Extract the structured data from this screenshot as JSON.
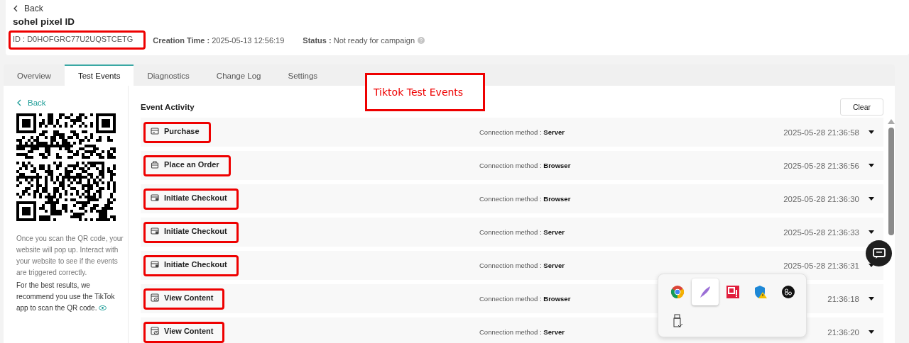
{
  "header": {
    "back": "Back",
    "title": "sohel pixel ID",
    "id_text": "ID : D0HOFGRC77U2UQSTCETG",
    "id_highlighted": true,
    "creation_label": "Creation Time :",
    "creation_value": "2025-05-13 12:56:19",
    "status_label": "Status :",
    "status_value": "Not ready for campaign"
  },
  "tabs": [
    {
      "label": "Overview",
      "selected": false
    },
    {
      "label": "Test Events",
      "selected": true
    },
    {
      "label": "Diagnostics",
      "selected": false
    },
    {
      "label": "Change Log",
      "selected": false
    },
    {
      "label": "Settings",
      "selected": false
    }
  ],
  "annotation": {
    "text": "Tiktok Test Events"
  },
  "sidebar": {
    "back": "Back",
    "hint": "Once you scan the QR code, your website will pop up. Interact with your website to see if the events are triggered correctly.",
    "recommendation": "For the best results, we recommend you use the TikTok app to scan the QR code."
  },
  "event_activity": {
    "title": "Event Activity",
    "clear_button": "Clear",
    "events": [
      {
        "kind": "purchase",
        "name": "Purchase",
        "connection_label": "Connection method :",
        "connection": "Server",
        "time": "2025-05-28 21:36:58",
        "highlighted": true
      },
      {
        "kind": "order",
        "name": "Place an Order",
        "connection_label": "Connection method :",
        "connection": "Browser",
        "time": "2025-05-28 21:36:56",
        "highlighted": true
      },
      {
        "kind": "checkout",
        "name": "Initiate Checkout",
        "connection_label": "Connection method :",
        "connection": "Browser",
        "time": "2025-05-28 21:36:30",
        "highlighted": true
      },
      {
        "kind": "checkout",
        "name": "Initiate Checkout",
        "connection_label": "Connection method :",
        "connection": "Server",
        "time": "2025-05-28 21:36:33",
        "highlighted": true
      },
      {
        "kind": "checkout",
        "name": "Initiate Checkout",
        "connection_label": "Connection method :",
        "connection": "Server",
        "time": "2025-05-28 21:36:31",
        "highlighted": true
      },
      {
        "kind": "view",
        "name": "View Content",
        "connection_label": "Connection method :",
        "connection": "Browser",
        "time": "21:36:18",
        "highlighted": true
      },
      {
        "kind": "view",
        "name": "View Content",
        "connection_label": "Connection method :",
        "connection": "Server",
        "time": "21:36:20",
        "highlighted": true
      }
    ]
  },
  "tray": {
    "items": [
      {
        "kind": "chrome",
        "selected": false
      },
      {
        "kind": "feather",
        "selected": true
      },
      {
        "kind": "alert-app",
        "selected": false
      },
      {
        "kind": "shield",
        "selected": false
      },
      {
        "kind": "round-app",
        "selected": false
      },
      {
        "kind": "usb",
        "selected": false
      }
    ]
  }
}
